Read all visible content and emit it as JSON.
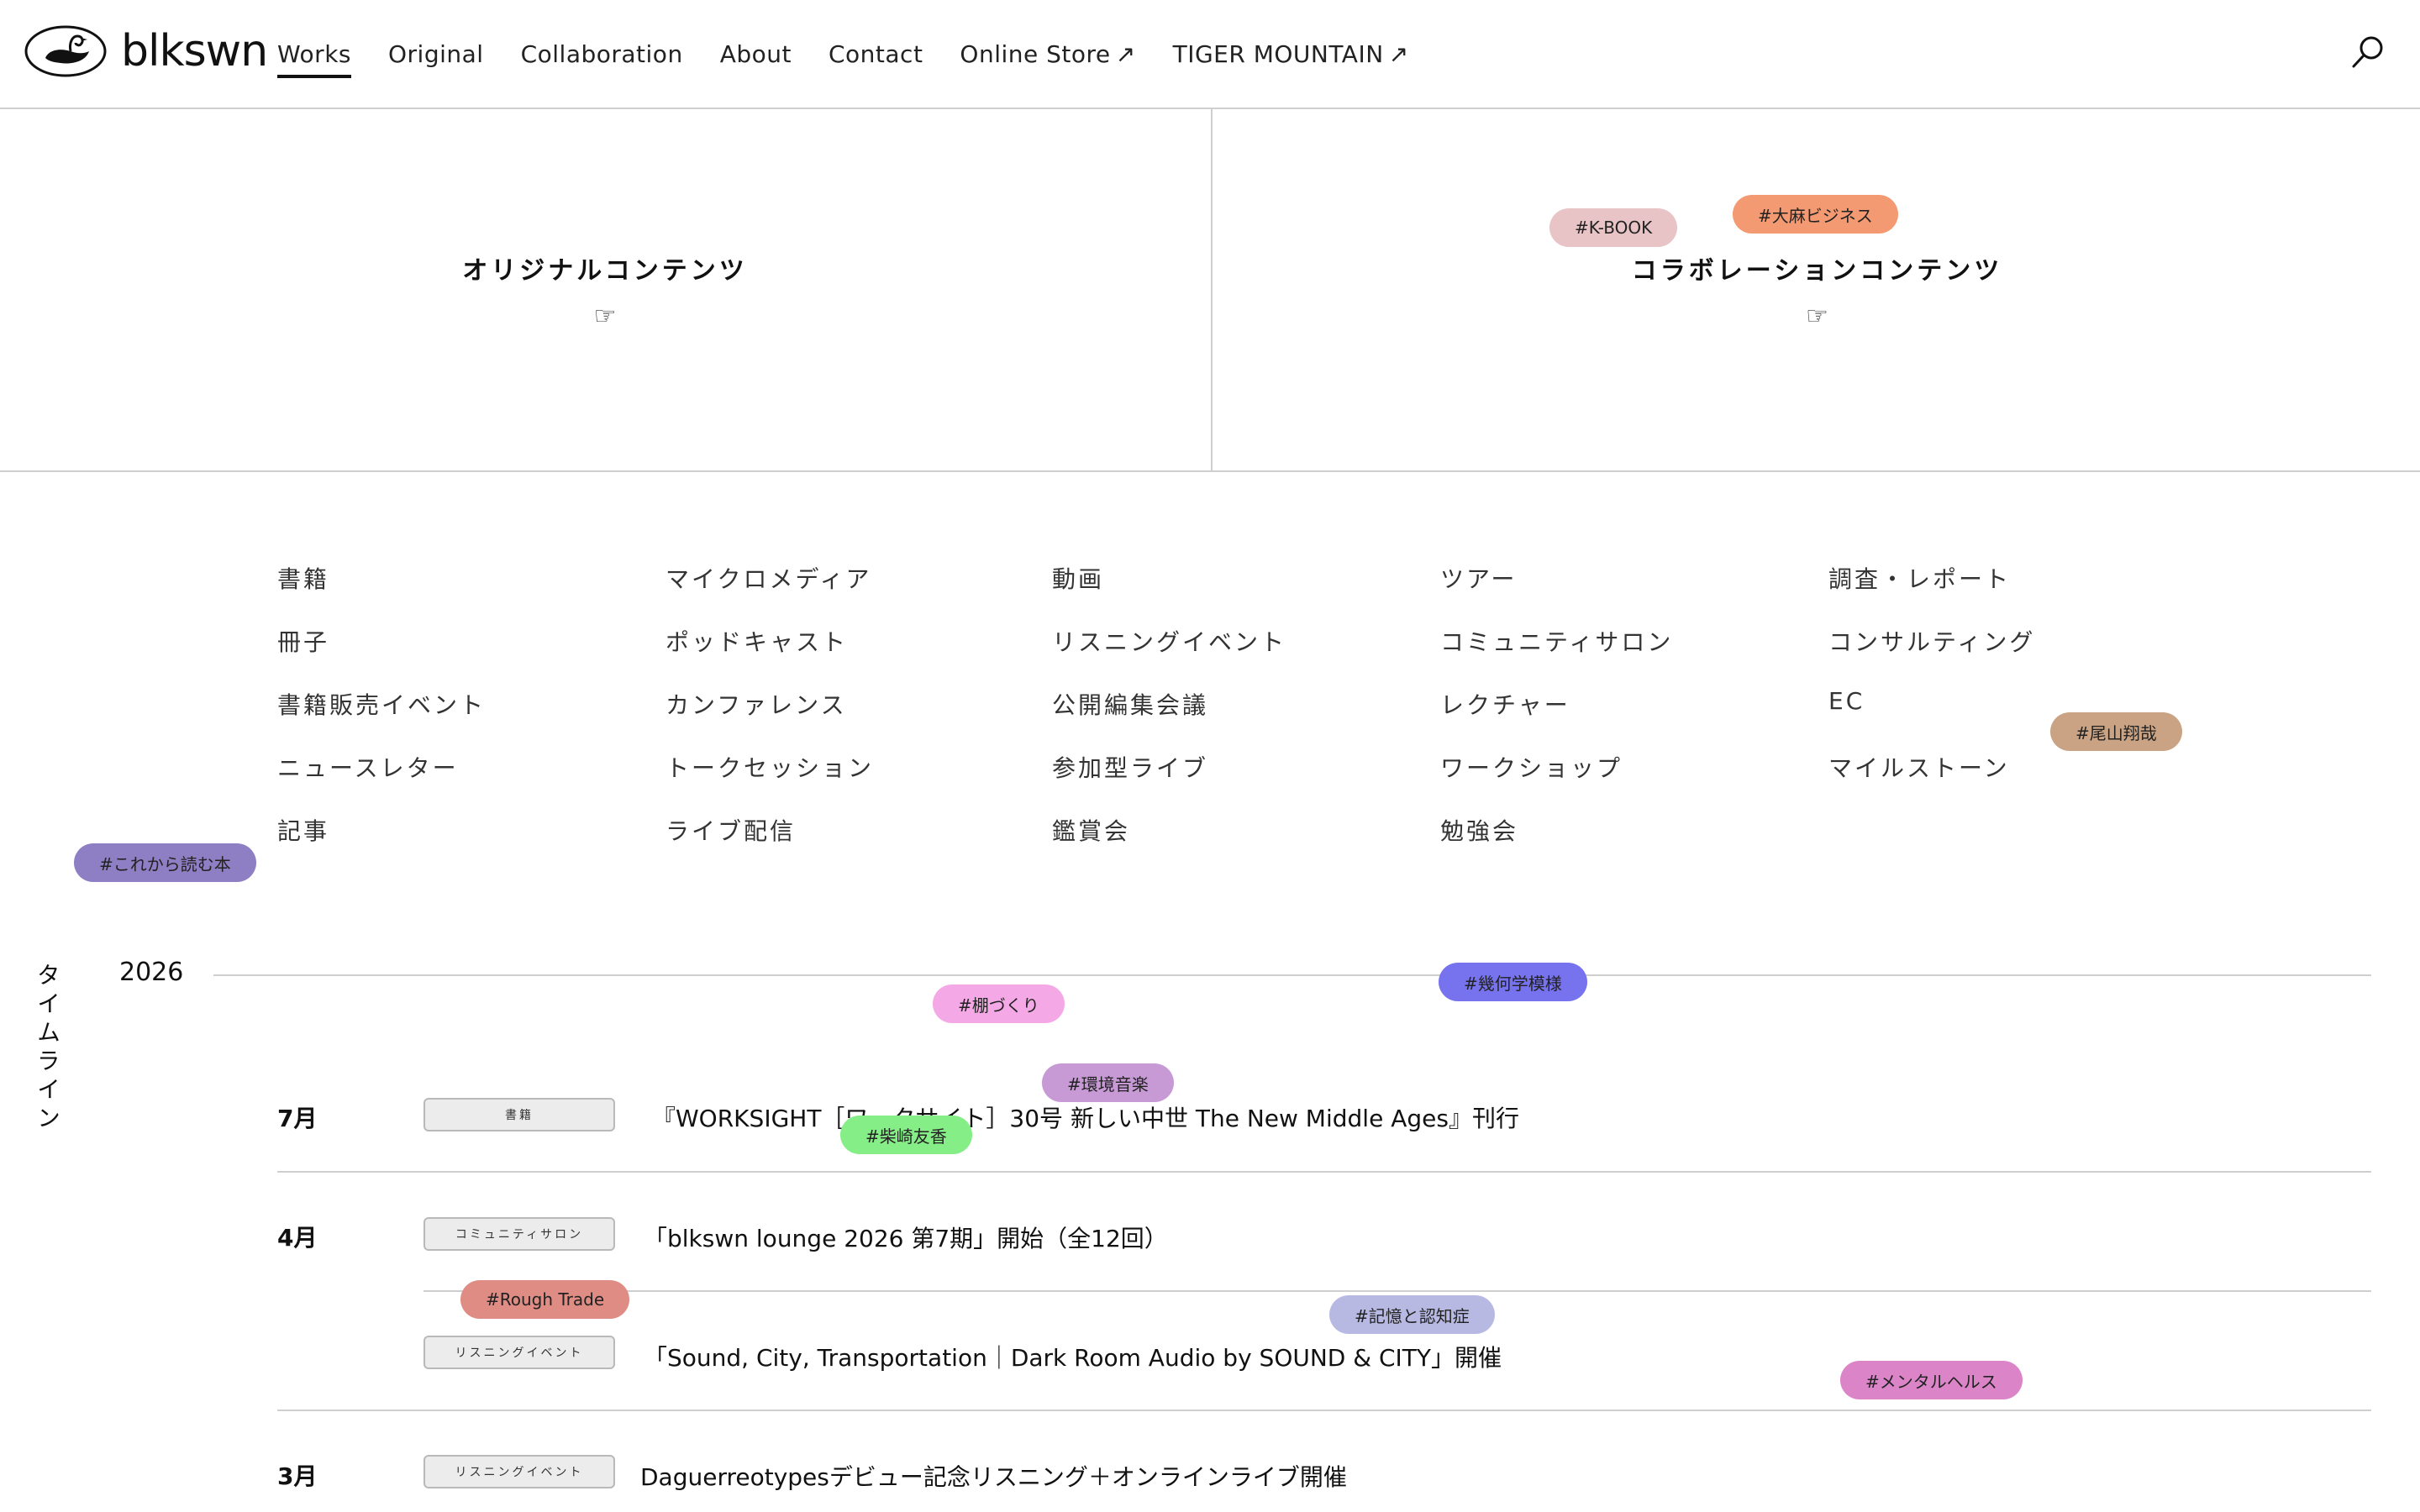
{
  "header": {
    "logo_text": "blkswn",
    "nav": [
      {
        "label": "Works",
        "active": true
      },
      {
        "label": "Original"
      },
      {
        "label": "Collaboration"
      },
      {
        "label": "About"
      },
      {
        "label": "Contact"
      },
      {
        "label": "Online Store",
        "external": "↗"
      },
      {
        "label": "TIGER MOUNTAIN",
        "external": "↗"
      }
    ],
    "search_icon": "search-icon"
  },
  "hero": {
    "original": {
      "title": "オリジナルコンテンツ",
      "pointer": "☞"
    },
    "collab": {
      "title": "コラボレーションコンテンツ",
      "pointer": "☞"
    }
  },
  "categories": [
    [
      "書籍",
      "冊子",
      "書籍販売イベント",
      "ニュースレター",
      "記事"
    ],
    [
      "マイクロメディア",
      "ポッドキャスト",
      "カンファレンス",
      "トークセッション",
      "ライブ配信"
    ],
    [
      "動画",
      "リスニングイベント",
      "公開編集会議",
      "参加型ライブ",
      "鑑賞会"
    ],
    [
      "ツアー",
      "コミュニティサロン",
      "レクチャー",
      "ワークショップ",
      "勉強会"
    ],
    [
      "調査・レポート",
      "コンサルティング",
      "EC",
      "マイルストーン"
    ]
  ],
  "timeline": {
    "label": "タイムライン",
    "year": "2026",
    "events": [
      {
        "month": "7月",
        "tag": "書籍",
        "title": "『WORKSIGHT［ワークサイト］30号 新しい中世 The New Middle Ages』刊行"
      },
      {
        "month": "4月",
        "tag": "コミュニティサロン",
        "title": "「blkswn lounge 2026 第7期」開始（全12回）"
      },
      {
        "month": "",
        "tag": "リスニングイベント",
        "title": "「Sound, City, Transportation｜Dark Room Audio by SOUND & CITY」開催"
      },
      {
        "month": "3月",
        "tag": "リスニングイベント",
        "title": "Daguerreotypesデビュー記念リスニング＋オンラインライブ開催"
      }
    ]
  },
  "hashtags": [
    {
      "label": "#K-BOOK",
      "color": "#e8c4c6"
    },
    {
      "label": "#大麻ビジネス",
      "color": "#f49a72"
    },
    {
      "label": "#尾山翔哉",
      "color": "#c9a384"
    },
    {
      "label": "#これから読む本",
      "color": "#8e7ec3"
    },
    {
      "label": "#棚づくり",
      "color": "#f4a9e6"
    },
    {
      "label": "#幾何学模様",
      "color": "#7773ee"
    },
    {
      "label": "#環境音楽",
      "color": "#c79ad6"
    },
    {
      "label": "#柴崎友香",
      "color": "#85ee86"
    },
    {
      "label": "#Rough Trade",
      "color": "#de8c84"
    },
    {
      "label": "#記憶と認知症",
      "color": "#b7b9e3"
    },
    {
      "label": "#メンタルヘルス",
      "color": "#db84c8"
    }
  ]
}
